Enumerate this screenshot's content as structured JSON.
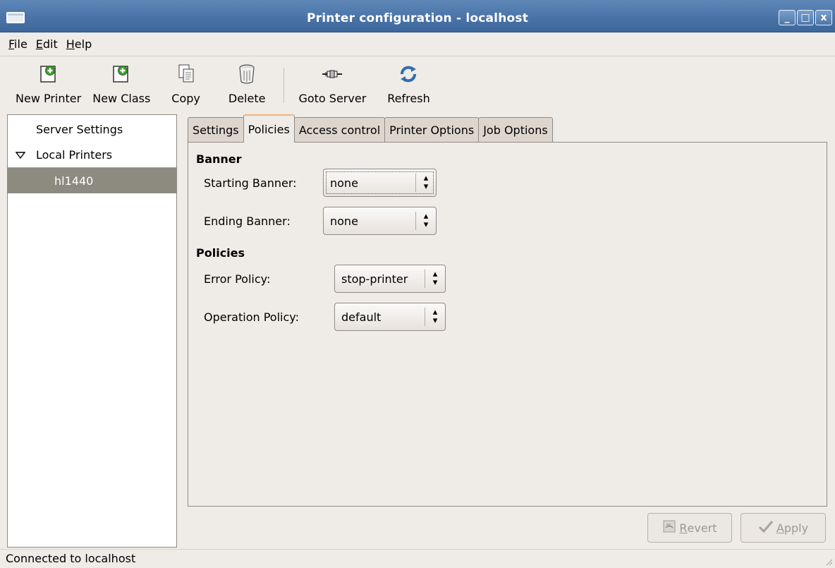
{
  "window": {
    "title": "Printer configuration - localhost",
    "buttons": {
      "minimize": "_",
      "maximize": "□",
      "close": "x"
    }
  },
  "menubar": {
    "file": {
      "mnemonic": "F",
      "rest": "ile"
    },
    "edit": {
      "mnemonic": "E",
      "rest": "dit"
    },
    "help": {
      "mnemonic": "H",
      "rest": "elp"
    }
  },
  "toolbar": {
    "new_printer": "New Printer",
    "new_class": "New Class",
    "copy": "Copy",
    "delete": "Delete",
    "goto_server": "Goto Server",
    "refresh": "Refresh"
  },
  "tree": {
    "server_settings": "Server Settings",
    "local_printers": "Local Printers",
    "printer": "hl1440"
  },
  "tabs": [
    "Settings",
    "Policies",
    "Access control",
    "Printer Options",
    "Job Options"
  ],
  "policies_tab": {
    "banner_section": "Banner",
    "starting_banner_label": "Starting Banner:",
    "starting_banner_value": "none",
    "ending_banner_label": "Ending Banner:",
    "ending_banner_value": "none",
    "policies_section": "Policies",
    "error_policy_label": "Error Policy:",
    "error_policy_value": "stop-printer",
    "operation_policy_label": "Operation Policy:",
    "operation_policy_value": "default"
  },
  "actions": {
    "revert": {
      "mnemonic": "R",
      "rest": "evert"
    },
    "apply": {
      "mnemonic": "A",
      "rest": "pply"
    }
  },
  "status": "Connected to localhost",
  "colors": {
    "titlebar": "#4a74a8",
    "background": "#efebe7",
    "selection": "#8d8a7f",
    "active_tab_accent": "#f0b57a"
  }
}
